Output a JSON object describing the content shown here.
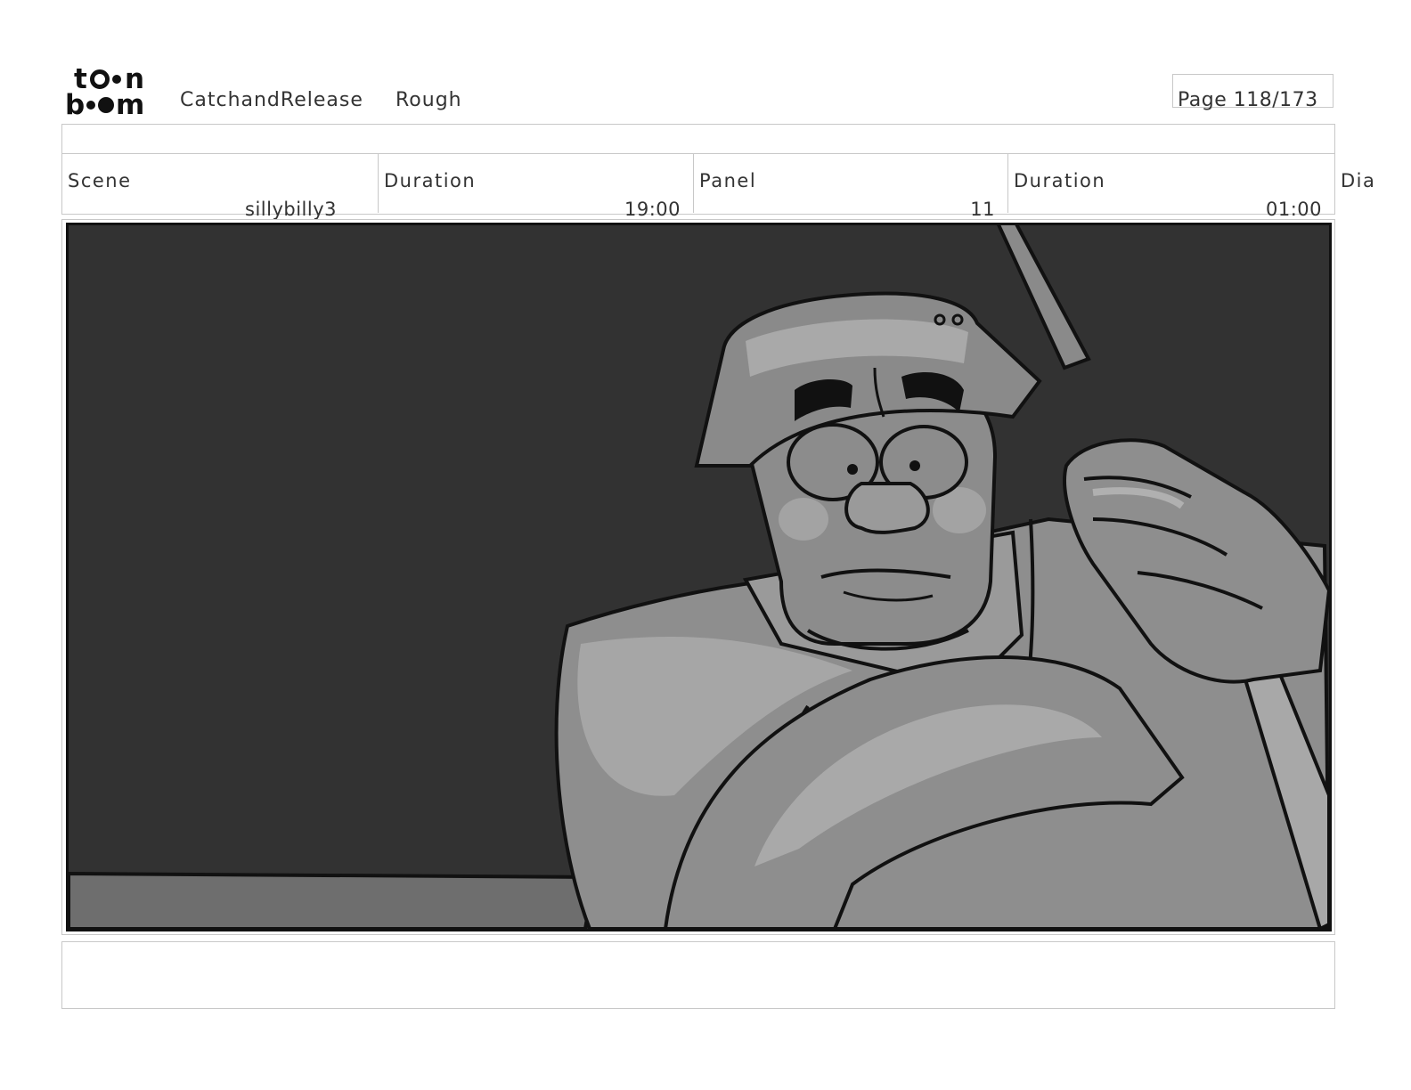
{
  "header": {
    "logo_top": "toon",
    "logo_bottom": "boom",
    "project": "CatchandRelease",
    "stage": "Rough",
    "page": "Page 118/173"
  },
  "info": {
    "scene_label": "Scene",
    "scene_value": "sillybilly3",
    "scene_duration_label": "Duration",
    "scene_duration_value": "19:00",
    "panel_label": "Panel",
    "panel_value": "11",
    "panel_duration_label": "Duration",
    "panel_duration_value": "01:00",
    "dialog_label": "Dia"
  },
  "panel_image": {
    "subject": "fisherman-in-bucket-hat-gripping-fishing-rod",
    "palette": {
      "bg": "#323232",
      "ground": "#6e6e6e",
      "skin": "#8c8c8c",
      "shirt": "#8e8e8e",
      "highlight": "#b4b4b4",
      "line": "#111111"
    }
  }
}
